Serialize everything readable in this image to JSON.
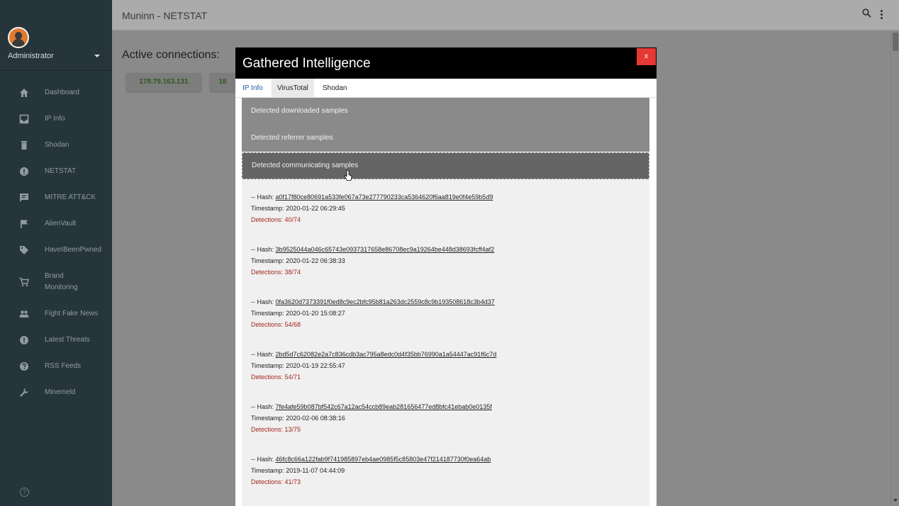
{
  "sidebar": {
    "user": "Administrator",
    "items": [
      {
        "label": "Dashboard",
        "icon": "home-icon"
      },
      {
        "label": "IP Info",
        "icon": "inbox-icon"
      },
      {
        "label": "Shodan",
        "icon": "trash-icon"
      },
      {
        "label": "NETSTAT",
        "icon": "alert-circle-icon"
      },
      {
        "label": "MITRE ATT&CK",
        "icon": "chat-icon"
      },
      {
        "label": "AlienVault",
        "icon": "flag-icon"
      },
      {
        "label": "HaveIBeenPwned",
        "icon": "tag-icon"
      },
      {
        "label": "Brand",
        "label2": "Monitoring",
        "icon": "cart-icon"
      },
      {
        "label": "Fight Fake News",
        "icon": "people-icon"
      },
      {
        "label": "Latest Threats",
        "icon": "alert-circle-icon"
      },
      {
        "label": "RSS Feeds",
        "icon": "help-circle-icon"
      },
      {
        "label": "Minemeld",
        "icon": "wrench-icon"
      }
    ],
    "help_glyph": "?"
  },
  "topbar": {
    "title": "Muninn - NETSTAT"
  },
  "content": {
    "heading": "Active connections:",
    "ips": [
      "178.79.163.131",
      "18"
    ]
  },
  "modal": {
    "title": "Gathered Intelligence",
    "close": "x",
    "tabs": [
      "IP Info",
      "VirusTotal",
      "Shodan"
    ],
    "sections": [
      "Detected downloaded samples",
      "Detected referrer samples",
      "Detected communicating samples"
    ],
    "hash_prefix": "-- Hash: ",
    "timestamp_prefix": "Timestamp: ",
    "detections_prefix": "Detections: ",
    "entries": [
      {
        "hash": "a0f17f80ce80691a533fe067a73e277790233ca5364620f6aa819e0f4e59b5d9",
        "timestamp": "2020-01-22 06:29:45",
        "detections": "40/74"
      },
      {
        "hash": "3b9525044a046c65743e0937317658e86708ec9a19264be448d38693fcff4af2",
        "timestamp": "2020-01-22 06:38:33",
        "detections": "38/74"
      },
      {
        "hash": "0fa3620d7373391f0ed8c9ec2bfc95b81a263dc2559c8c9b193508618c3b4d37",
        "timestamp": "2020-01-20 15:08:27",
        "detections": "54/68"
      },
      {
        "hash": "2bd5d7c62082e2a7c836cdb3ac795a8edc0d4f35bb76990a1a54447ac91f6c7d",
        "timestamp": "2020-01-19 22:55:47",
        "detections": "54/71"
      },
      {
        "hash": "7fe4afe59b087bf542c67a12ac54ccb89eab281656477ed8bfc41ebab0e0135f",
        "timestamp": "2020-02-06 08:38:16",
        "detections": "13/75"
      },
      {
        "hash": "46fc8c66a122fab9f741985897eb4ae0985f5c85803e47f214187730f0ea64ab",
        "timestamp": "2019-11-07 04:44:09",
        "detections": "41/73"
      }
    ]
  },
  "colors": {
    "sidebar_bg": "#26343b",
    "modal_header": "#000000",
    "close_button": "#e53935",
    "detections_text": "#a3261c",
    "ip_text": "#2f5a1f"
  }
}
